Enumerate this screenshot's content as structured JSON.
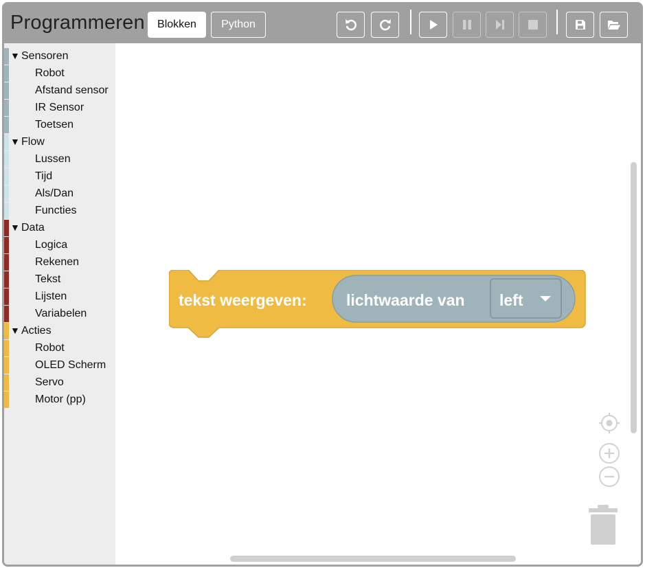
{
  "app": {
    "title": "Programmeren"
  },
  "modes": {
    "blocks_label": "Blokken",
    "python_label": "Python",
    "active": "blocks"
  },
  "toolbar": {
    "buttons": [
      {
        "icon": "undo-icon",
        "enabled": true
      },
      {
        "icon": "redo-icon",
        "enabled": true
      },
      {
        "icon": "play-icon",
        "enabled": true
      },
      {
        "icon": "pause-icon",
        "enabled": false
      },
      {
        "icon": "step-icon",
        "enabled": false
      },
      {
        "icon": "stop-icon",
        "enabled": false
      },
      {
        "icon": "save-icon",
        "enabled": true
      },
      {
        "icon": "folder-open-icon",
        "enabled": true
      }
    ]
  },
  "toolbox": {
    "categories": [
      {
        "label": "Sensoren",
        "color": "#9fb4ba",
        "items": [
          "Robot",
          "Afstand sensor",
          "IR Sensor",
          "Toetsen"
        ]
      },
      {
        "label": "Flow",
        "color": "#cfe3ea",
        "items": [
          "Lussen",
          "Tijd",
          "Als/Dan",
          "Functies"
        ]
      },
      {
        "label": "Data",
        "color": "#8e2b23",
        "items": [
          "Logica",
          "Rekenen",
          "Tekst",
          "Lijsten",
          "Variabelen"
        ]
      },
      {
        "label": "Acties",
        "color": "#f0bb43",
        "items": [
          "Robot",
          "OLED Scherm",
          "Servo",
          "Motor (pp)"
        ]
      }
    ]
  },
  "workspace": {
    "block": {
      "label": "tekst weergeven:",
      "color": "#f0bb43",
      "input": {
        "label": "lichtwaarde van",
        "color": "#9fb4ba",
        "dropdown_value": "left"
      }
    },
    "controls": [
      "recenter-icon",
      "zoom-in-icon",
      "zoom-out-icon",
      "trash-icon"
    ]
  }
}
